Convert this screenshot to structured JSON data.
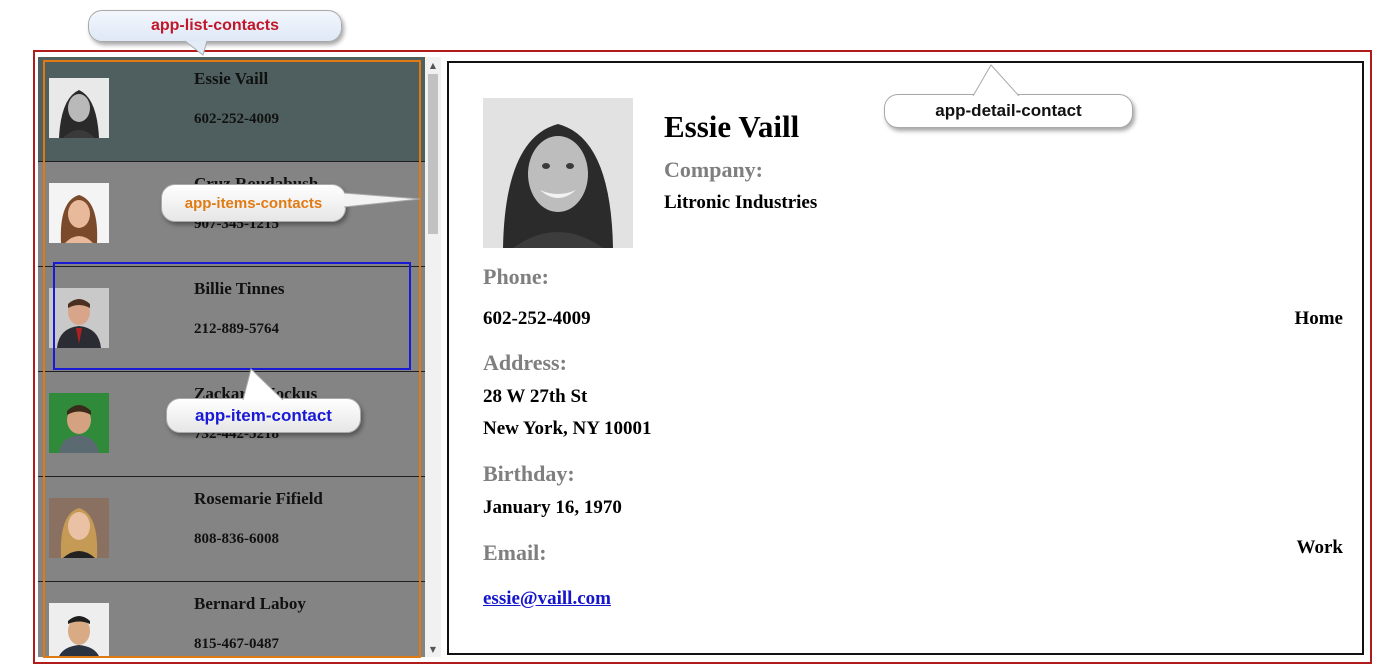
{
  "callouts": {
    "list": "app-list-contacts",
    "items": "app-items-contacts",
    "item": "app-item-contact",
    "detail": "app-detail-contact"
  },
  "contacts": [
    {
      "name": "Essie Vaill",
      "phone": "602-252-4009"
    },
    {
      "name": "Cruz Roudabush",
      "phone": "907-345-1215"
    },
    {
      "name": "Billie Tinnes",
      "phone": "212-889-5764"
    },
    {
      "name": "Zackary Mockus",
      "phone": "732-442-5218"
    },
    {
      "name": "Rosemarie Fifield",
      "phone": "808-836-6008"
    },
    {
      "name": "Bernard Laboy",
      "phone": "815-467-0487"
    }
  ],
  "scrollbar": {
    "up_glyph": "▲",
    "down_glyph": "▼"
  },
  "detail": {
    "name": "Essie Vaill",
    "company_label": "Company:",
    "company": "Litronic Industries",
    "phone_label": "Phone:",
    "phone": "602-252-4009",
    "phone_type": "Home",
    "address_label": "Address:",
    "address_line1": "28 W 27th St",
    "address_line2": "New York, NY 10001",
    "birthday_label": "Birthday:",
    "birthday": "January 16, 1970",
    "email_label": "Email:",
    "email_type": "Work",
    "email": "essie@vaill.com"
  },
  "colors": {
    "list_frame": "#b01c1c",
    "items_frame": "#e07b13",
    "item_frame": "#1a1ad6",
    "selected_row": "#4f5f5f",
    "row_background": "#848484"
  }
}
